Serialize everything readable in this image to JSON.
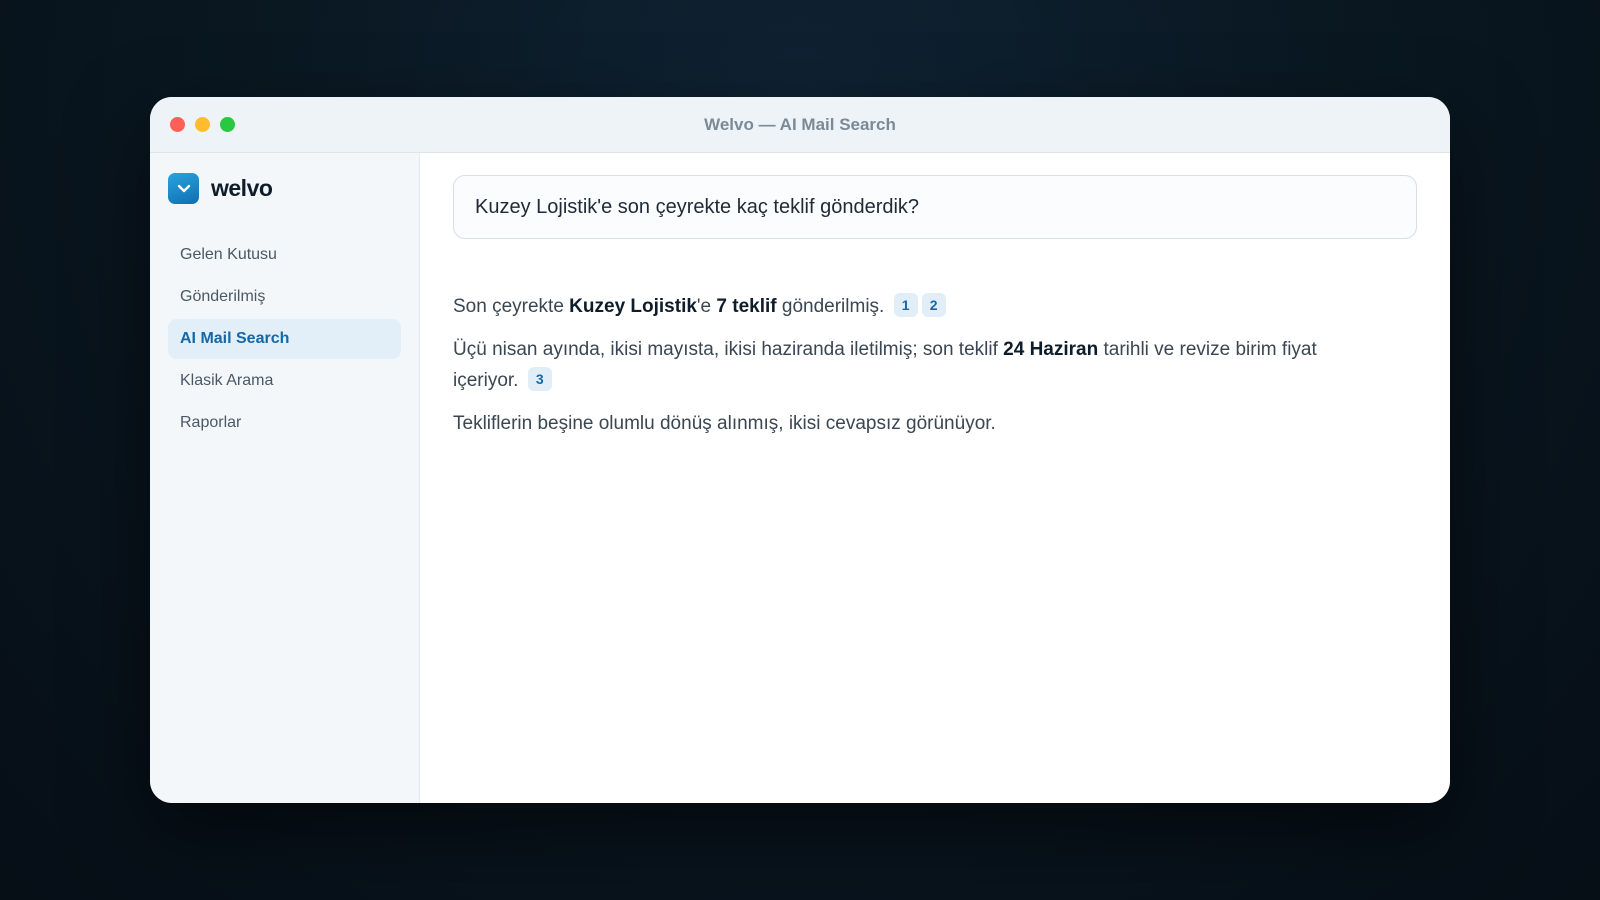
{
  "window": {
    "title": "Welvo — AI Mail Search"
  },
  "brand": {
    "name": "welvo",
    "icon": "chevron-down-icon",
    "accent": "#1a86c9"
  },
  "sidebar": {
    "items": [
      {
        "label": "Gelen Kutusu",
        "active": false
      },
      {
        "label": "Gönderilmiş",
        "active": false
      },
      {
        "label": "AI Mail Search",
        "active": true
      },
      {
        "label": "Klasik Arama",
        "active": false
      },
      {
        "label": "Raporlar",
        "active": false
      }
    ]
  },
  "search": {
    "query": "Kuzey Lojistik'e son çeyrekte kaç teklif gönderdik?"
  },
  "answer": {
    "p1": {
      "t1": "Son çeyrekte ",
      "b1": "Kuzey Lojistik",
      "t2": "'e ",
      "b2": "7 teklif",
      "t3": " gönderilmiş.",
      "cites": [
        "1",
        "2"
      ]
    },
    "p2": {
      "t1": "Üçü nisan ayında, ikisi mayısta, ikisi haziranda iletilmiş; son teklif ",
      "b1": "24 Haziran",
      "t2": " tarihli ve revize birim fiyat içeriyor.",
      "cites": [
        "3"
      ]
    },
    "p3": {
      "t1": "Tekliflerin beşine olumlu dönüş alınmış, ikisi cevapsız görünüyor."
    }
  }
}
